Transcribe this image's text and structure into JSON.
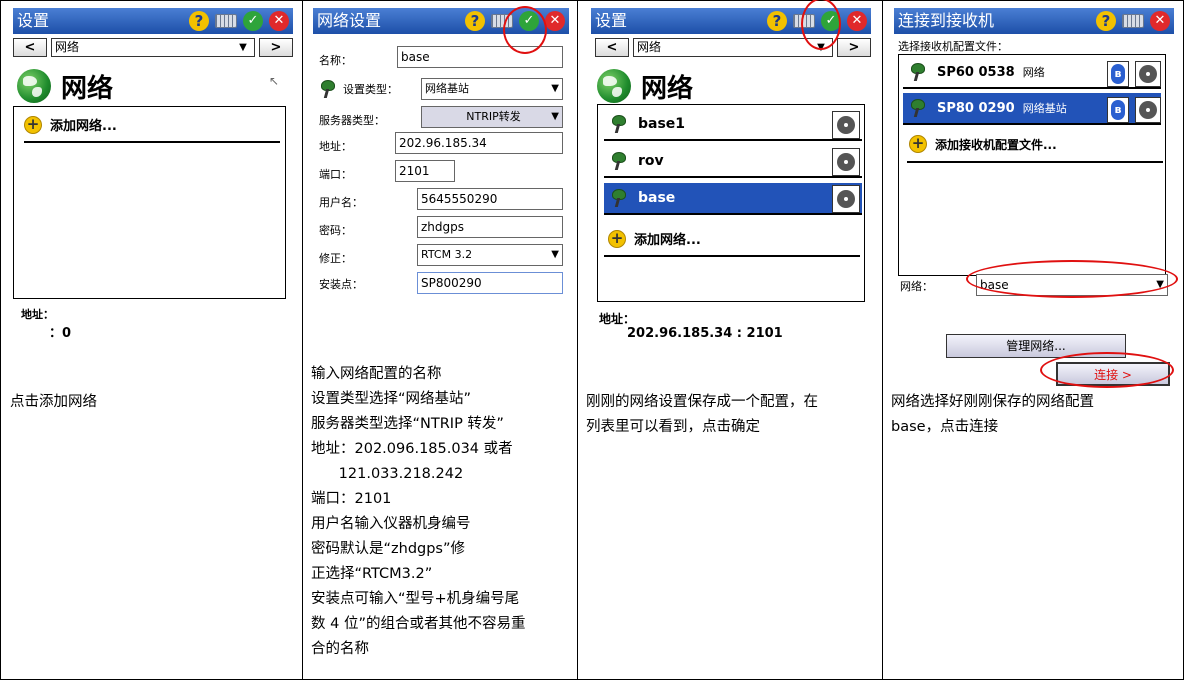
{
  "panel1": {
    "title": "设置",
    "nav_prev": "<",
    "nav_next": ">",
    "nav_value": "网络",
    "heading": "网络",
    "add_network": "添加网络...",
    "address_label": "地址：",
    "address_value": "：0",
    "caption": "点击添加网络"
  },
  "panel2": {
    "title": "网络设置",
    "fields": {
      "name_label": "名称：",
      "name_value": "base",
      "type_label": "设置类型：",
      "type_value": "网络基站",
      "server_label": "服务器类型：",
      "server_value": "NTRIP转发",
      "addr_label": "地址：",
      "addr_value": "202.96.185.34",
      "port_label": "端口：",
      "port_value": "2101",
      "user_label": "用户名：",
      "user_value": "5645550290",
      "pwd_label": "密码：",
      "pwd_value": "zhdgps",
      "corr_label": "修正：",
      "corr_value": "RTCM 3.2",
      "mount_label": "安装点：",
      "mount_value": "SP800290"
    },
    "caption_lines": [
      "输入网络配置的名称",
      "设置类型选择“网络基站”",
      "服务器类型选择“NTRIP 转发”",
      "地址：202.096.185.034 或者",
      "      121.033.218.242",
      "端口：2101",
      "用户名输入仪器机身编号",
      "密码默认是“zhdgps”修",
      "正选择“RTCM3.2”",
      "安装点可输入“型号+机身编号尾",
      "数 4 位”的组合或者其他不容易重",
      "合的名称"
    ]
  },
  "panel3": {
    "title": "设置",
    "nav_prev": "<",
    "nav_next": ">",
    "nav_value": "网络",
    "heading": "网络",
    "items": [
      "base1",
      "rov",
      "base"
    ],
    "add_network": "添加网络...",
    "address_label": "地址：",
    "address_value": "202.96.185.34 : 2101",
    "caption_lines": [
      "刚刚的网络设置保存成一个配置，在",
      "列表里可以看到，点击确定"
    ]
  },
  "panel4": {
    "title": "连接到接收机",
    "select_label": "选择接收机配置文件：",
    "receivers": [
      {
        "name": "SP60 0538",
        "type": "网络"
      },
      {
        "name": "SP80 0290",
        "type": "网络基站"
      }
    ],
    "add_receiver": "添加接收机配置文件...",
    "network_label": "网络：",
    "network_value": "base",
    "manage_button": "管理网络...",
    "connect_button": "连接 >",
    "caption_lines": [
      "网络选择好刚刚保存的网络配置",
      "base，点击连接"
    ]
  },
  "colors": {
    "titlebar": "#1d4fa8",
    "selection": "#2253b8",
    "highlight_circle": "#e01010",
    "connect_text": "#e01010"
  }
}
